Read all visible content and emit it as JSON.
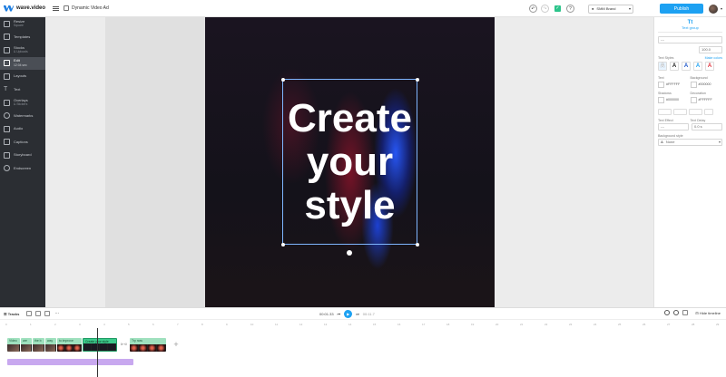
{
  "app": {
    "logo_text": "wave.video",
    "project_title": "Dynamic Video Ad",
    "brand_select": "SMM Brand",
    "publish_label": "Publish",
    "help_label": "?"
  },
  "sidebar": {
    "items": [
      {
        "label": "Resize",
        "sub": "Square",
        "icon": "resize-icon"
      },
      {
        "label": "Templates",
        "sub": "",
        "icon": "templates-icon"
      },
      {
        "label": "Stocks",
        "sub": "& Uploads",
        "icon": "stocks-icon"
      },
      {
        "label": "Edit",
        "sub": "12:04 sec",
        "icon": "edit-icon"
      },
      {
        "label": "Layouts",
        "sub": "",
        "icon": "layouts-icon"
      },
      {
        "label": "Text",
        "sub": "",
        "icon": "text-icon"
      },
      {
        "label": "Overlays",
        "sub": "& Stickers",
        "icon": "overlays-icon"
      },
      {
        "label": "Watermarks",
        "sub": "",
        "icon": "watermarks-icon"
      },
      {
        "label": "Audio",
        "sub": "",
        "icon": "audio-icon"
      },
      {
        "label": "Captions",
        "sub": "",
        "icon": "captions-icon"
      },
      {
        "label": "Storyboard",
        "sub": "",
        "icon": "storyboard-icon"
      },
      {
        "label": "Endscreen",
        "sub": "",
        "icon": "endscreen-icon"
      }
    ],
    "active_index": 3
  },
  "canvas": {
    "text_lines": [
      "Create",
      "your",
      "style"
    ]
  },
  "right_panel": {
    "tab_label": "Text group",
    "font_value": "---",
    "size_value": "100.0",
    "text_styles_label": "Text Styles",
    "more_colors_label": "Make colors",
    "style_letters": [
      "A",
      "A",
      "A",
      "A",
      "A"
    ],
    "text_label": "Text",
    "text_color": "#FFFFFF",
    "background_label": "Background",
    "background_color": "#000000",
    "shadows_label": "Shadows",
    "shadows_color": "#000000",
    "decoration_label": "Decoration",
    "decoration_color": "#FFFFFF",
    "text_effect_label": "Text Effect",
    "text_delay_label": "Text Delay",
    "text_effect_value": "---",
    "text_delay_value": "0.0 s",
    "background_style_label": "Background style",
    "background_style_value": "None"
  },
  "timeline": {
    "tracks_label": "Tracks",
    "current_time": "00:01.33",
    "total_time": "00:11.7",
    "hide_timeline_label": "Hide timeline",
    "ruler_ticks": [
      "0",
      "1",
      "2",
      "3",
      "4",
      "5",
      "6",
      "7",
      "8",
      "9",
      "10",
      "11",
      "12",
      "13",
      "14",
      "15",
      "16",
      "17",
      "18",
      "19",
      "20",
      "21",
      "22",
      "23",
      "24",
      "25",
      "26",
      "27",
      "28",
      "29"
    ],
    "clips": [
      {
        "label": "Video",
        "color": "#9fe0be"
      },
      {
        "label": "are",
        "color": "#9fe0be"
      },
      {
        "label": "the b",
        "color": "#9fe0be"
      },
      {
        "label": "way",
        "color": "#9fe0be"
      },
      {
        "label": "to improve",
        "color": "#9fe0be"
      },
      {
        "label": "Create your style",
        "color": "#3cc98a"
      },
      {
        "label": "Try now",
        "color": "#9fe0be"
      }
    ]
  },
  "colors": {
    "accent": "#1da1f2",
    "sidebar_bg": "#2b2e33",
    "clip_green": "#9fe0be",
    "audio_purple": "#c8a8ef"
  }
}
